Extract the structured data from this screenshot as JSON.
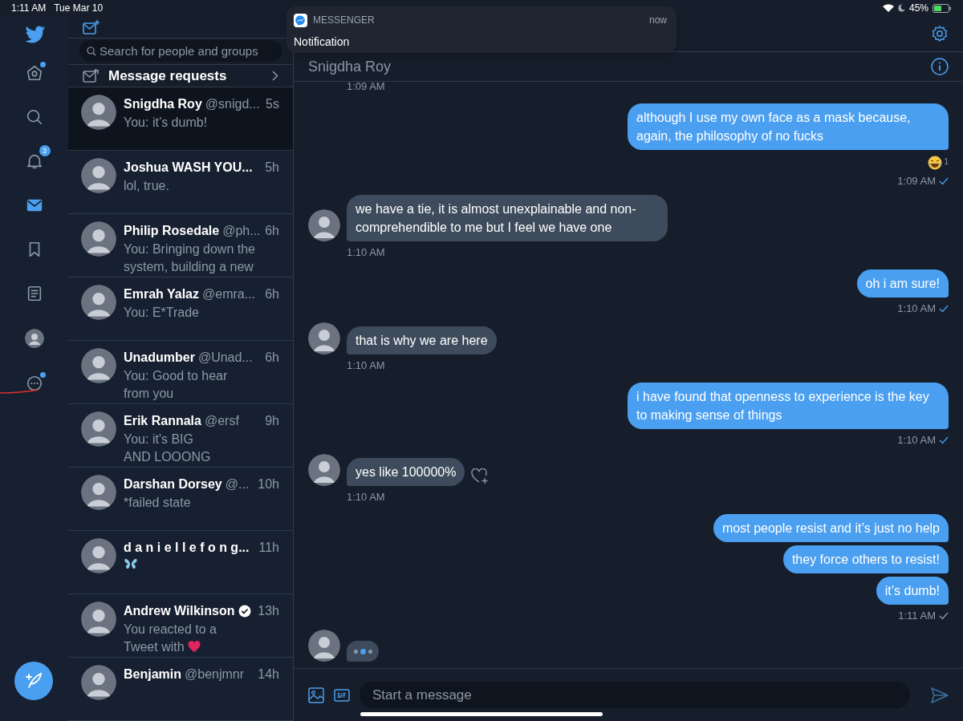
{
  "status_bar": {
    "time": "1:11 AM",
    "date": "Tue Mar 10",
    "battery": "45%"
  },
  "notification": {
    "app": "MESSENGER",
    "time": "now",
    "text": "Notification"
  },
  "nav": [
    {
      "kind": "home",
      "selected": false,
      "dot": true
    },
    {
      "kind": "search",
      "selected": false,
      "dot": false
    },
    {
      "kind": "bell",
      "selected": false,
      "dot": false,
      "badge": "3"
    },
    {
      "kind": "mail",
      "selected": true,
      "dot": false
    },
    {
      "kind": "bookmark",
      "selected": false,
      "dot": false
    },
    {
      "kind": "list",
      "selected": false,
      "dot": false
    },
    {
      "kind": "profile",
      "selected": false,
      "dot": false
    },
    {
      "kind": "more",
      "selected": false,
      "dot": true
    }
  ],
  "search": {
    "placeholder": "Search for people and groups"
  },
  "message_requests": {
    "label": "Message requests"
  },
  "conversations": [
    {
      "name": "Snigdha Roy",
      "handle": "@snigd...",
      "time": "5s",
      "preview": "You: it’s dumb!",
      "selected": true,
      "verified": false
    },
    {
      "name": "Joshua WASH YOU...",
      "time": "5h",
      "preview": "lol, true.",
      "selected": false,
      "verified": false
    },
    {
      "name": "Philip Rosedale",
      "handle": "@ph...",
      "time": "6h",
      "preview": "You: Bringing down the\nsystem, building a new",
      "selected": false,
      "verified": false
    },
    {
      "name": "Emrah Yalaz",
      "handle": "@emra...",
      "time": "6h",
      "preview": "You: E*Trade",
      "selected": false,
      "verified": false
    },
    {
      "name": "Unadumber",
      "handle": "@Unad...",
      "time": "6h",
      "preview": "You: Good to hear\nfrom you",
      "selected": false,
      "verified": false
    },
    {
      "name": "Erik Rannala",
      "handle": "@ersf",
      "time": "9h",
      "preview": "You: it's BIG\nAND LOOONG",
      "selected": false,
      "verified": false
    },
    {
      "name": "Darshan Dorsey",
      "handle": "@...",
      "time": "10h",
      "preview": "*failed state",
      "selected": false,
      "verified": false
    },
    {
      "name": "d a n i e l l e f o n g...",
      "time": "11h",
      "kind": "butterfly",
      "selected": false,
      "verified": false
    },
    {
      "name": "Andrew Wilkinson",
      "time": "13h",
      "preview": "You reacted to a\nTweet with",
      "kind": "heart",
      "selected": false,
      "verified": true
    },
    {
      "name": "Benjamin",
      "handle": "@benjmnr",
      "time": "14h",
      "selected": false,
      "verified": false
    }
  ],
  "chat": {
    "title": "Snigdha Roy",
    "messages": [
      {
        "kind": "time",
        "time": "1:09 AM"
      },
      {
        "kind": "sent",
        "bubbles": [
          "although I use my own face as a mask because, again, the philosophy of no fucks"
        ],
        "reaction_count": "1",
        "time": "1:09 AM",
        "read": true
      },
      {
        "kind": "received",
        "bubbles": [
          "we have a tie, it is almost unexplainable and non-comprehendible to me but I feel we have one"
        ],
        "time": "1:10 AM",
        "like_button": false
      },
      {
        "kind": "sent",
        "bubbles": [
          "oh i am sure!"
        ],
        "time": "1:10 AM",
        "read": true
      },
      {
        "kind": "received",
        "bubbles": [
          "that is why we are here"
        ],
        "time": "1:10 AM",
        "like_button": false
      },
      {
        "kind": "sent",
        "bubbles": [
          "i have found that openness to experience is the key to making sense of things"
        ],
        "time": "1:10 AM",
        "read": true
      },
      {
        "kind": "received",
        "bubbles": [
          "yes like 100000%"
        ],
        "time": "1:10 AM",
        "like_button": true
      },
      {
        "kind": "sent",
        "bubbles": [
          "most people resist and it’s just no help",
          "they force others to resist!",
          "it’s dumb!"
        ],
        "time": "1:11 AM",
        "read": false
      },
      {
        "kind": "typing"
      }
    ],
    "composer": {
      "placeholder": "Start a message"
    }
  }
}
